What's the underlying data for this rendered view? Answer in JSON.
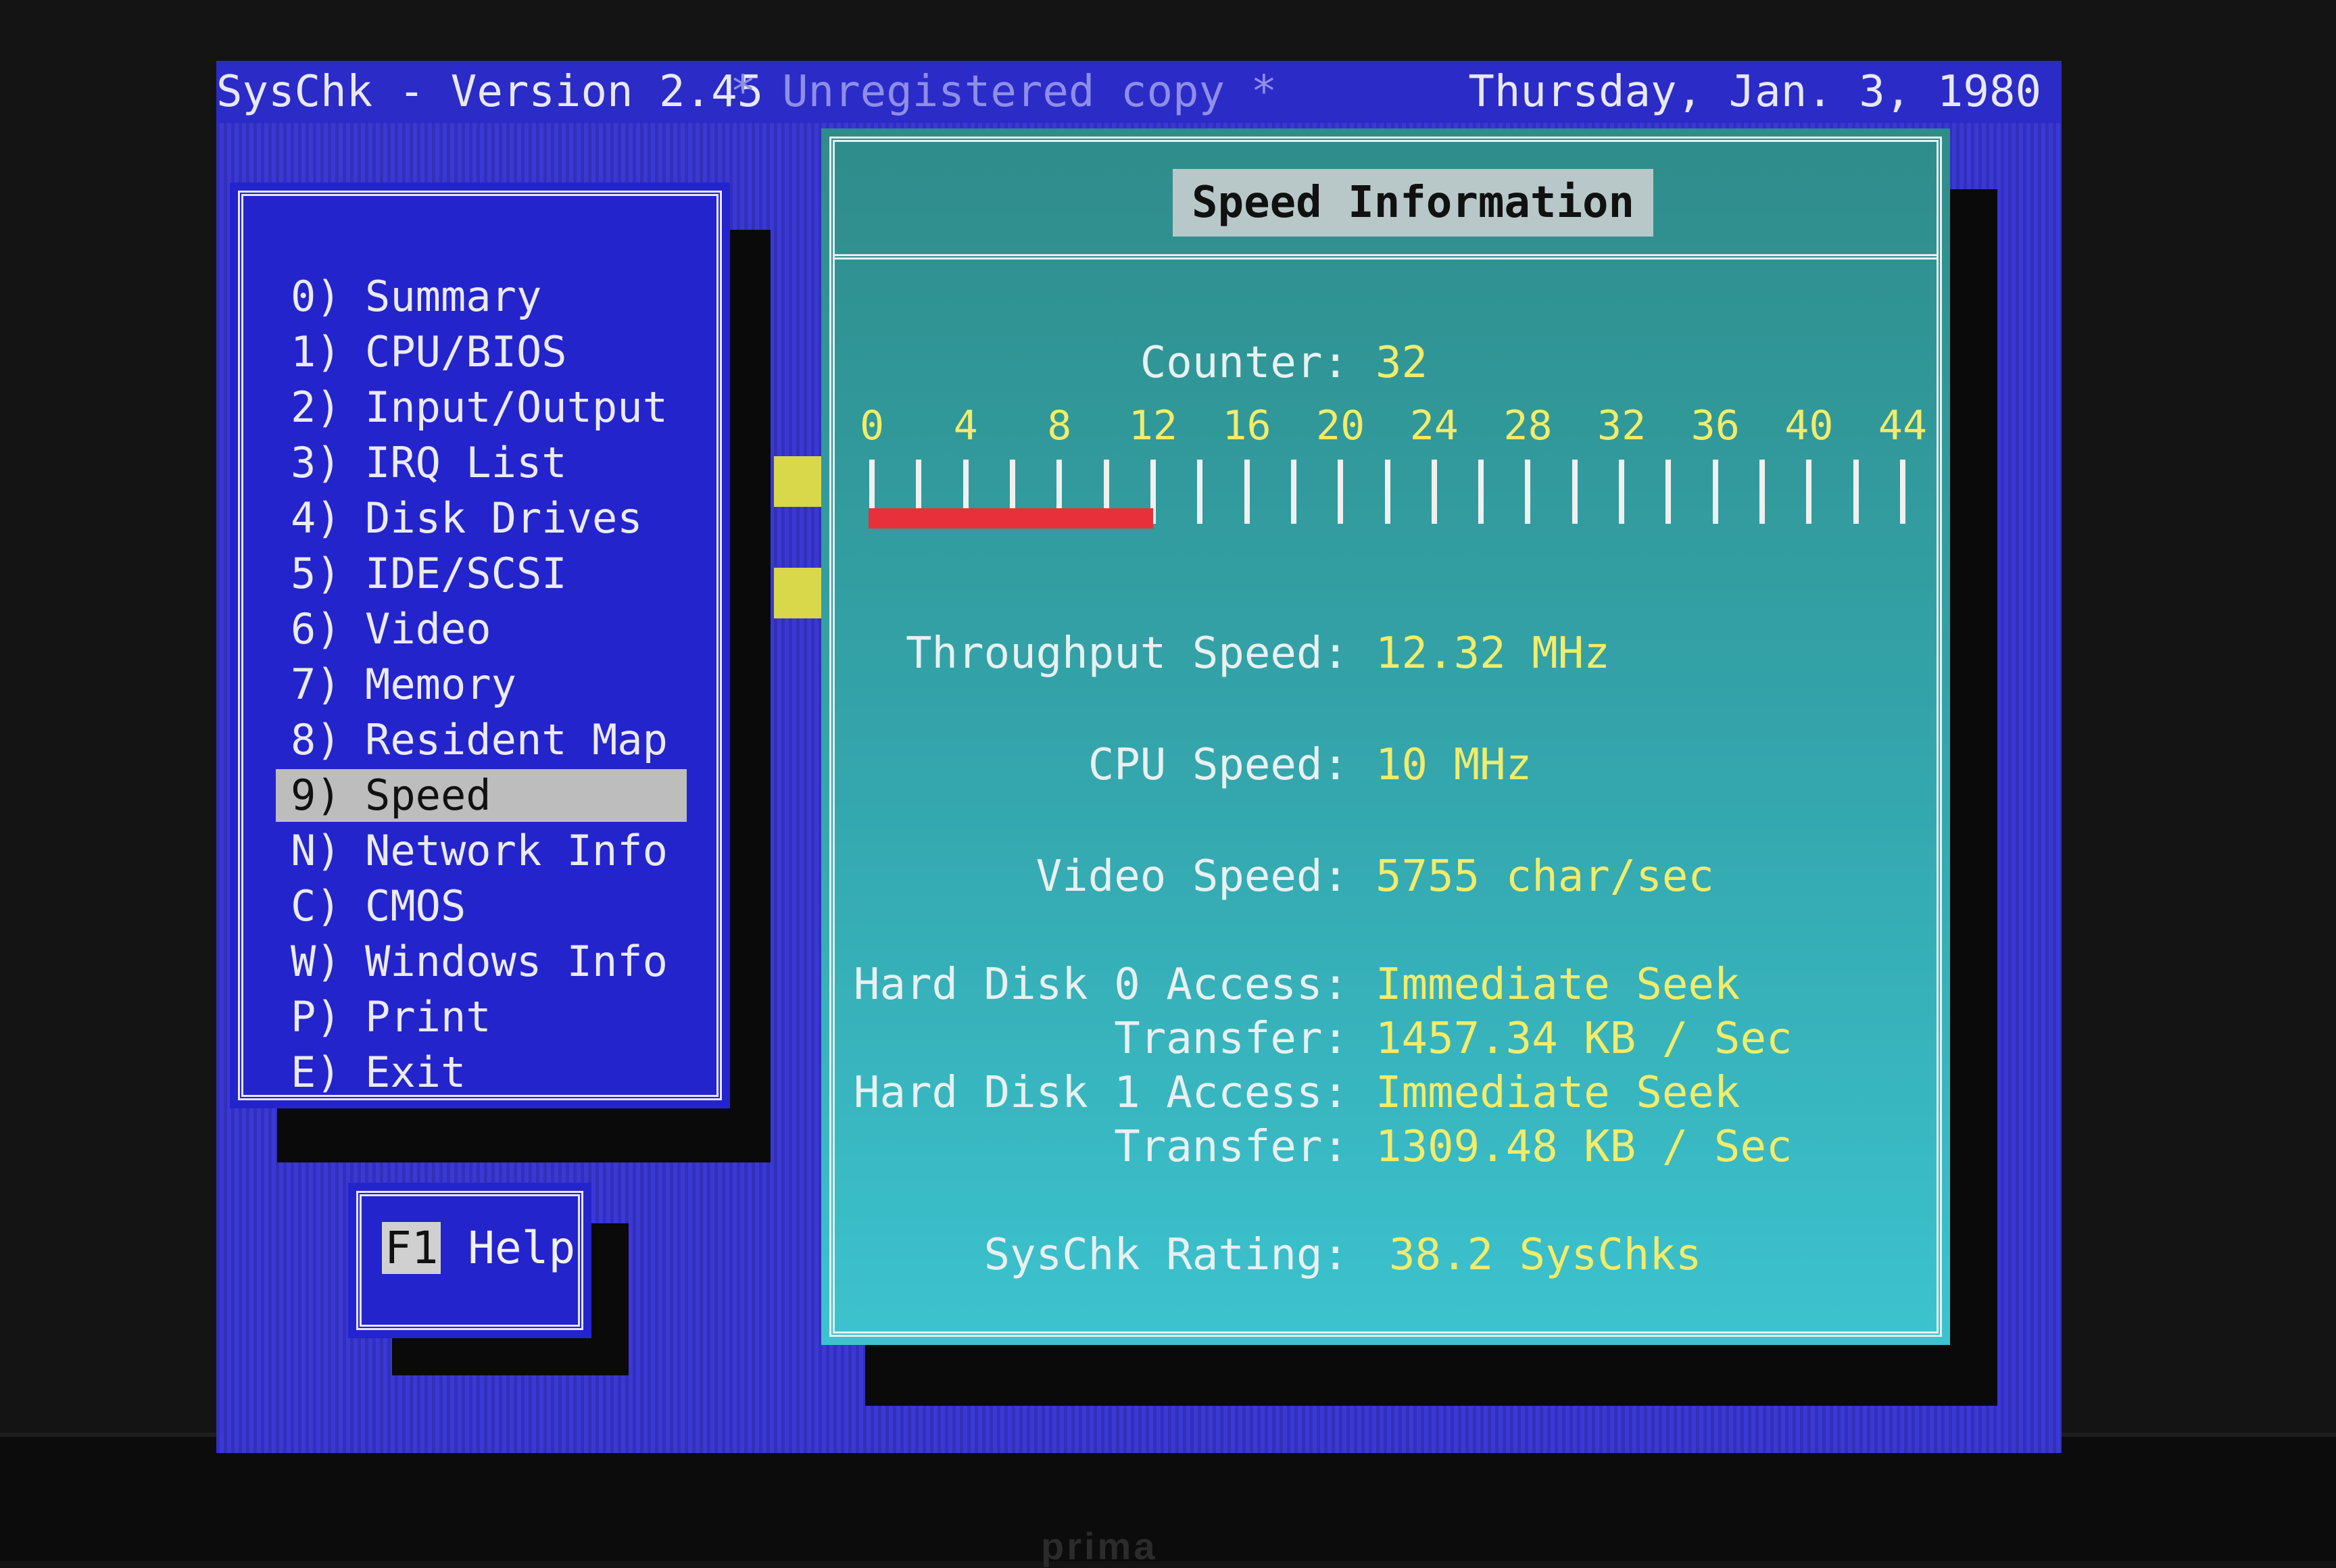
{
  "titlebar": {
    "app": "SysChk - Version 2.45",
    "unregistered": "* Unregistered copy *",
    "date": "Thursday, Jan. 3, 1980"
  },
  "menu": {
    "items": [
      {
        "key": "0)",
        "label": "Summary"
      },
      {
        "key": "1)",
        "label": "CPU/BIOS"
      },
      {
        "key": "2)",
        "label": "Input/Output"
      },
      {
        "key": "3)",
        "label": "IRQ List"
      },
      {
        "key": "4)",
        "label": "Disk Drives"
      },
      {
        "key": "5)",
        "label": "IDE/SCSI"
      },
      {
        "key": "6)",
        "label": "Video"
      },
      {
        "key": "7)",
        "label": "Memory"
      },
      {
        "key": "8)",
        "label": "Resident Map"
      },
      {
        "key": "9)",
        "label": "Speed"
      },
      {
        "key": "N)",
        "label": "Network Info"
      },
      {
        "key": "C)",
        "label": "CMOS"
      },
      {
        "key": "W)",
        "label": "Windows Info"
      },
      {
        "key": "P)",
        "label": "Print"
      },
      {
        "key": "E)",
        "label": "Exit"
      }
    ],
    "selected_index": 9
  },
  "help": {
    "key": "F1",
    "label": "Help"
  },
  "speed": {
    "title": "Speed Information",
    "counter_label": "Counter:",
    "counter_value": "32",
    "scale_labels": [
      "0",
      "4",
      "8",
      "12",
      "16",
      "20",
      "24",
      "28",
      "32",
      "36",
      "40",
      "44"
    ],
    "scale_max": 44,
    "bar_value": 12,
    "throughput_label": "Throughput Speed:",
    "throughput_value": "12.32 MHz",
    "cpu_label": "CPU Speed:",
    "cpu_value": "10 MHz",
    "video_label": "Video Speed:",
    "video_value": "5755 char/sec",
    "hd0_label": "Hard Disk 0 Access:",
    "hd0_value": "Immediate Seek",
    "hd0_transfer_label": "Transfer:",
    "hd0_transfer_value": "1457.34 KB / Sec",
    "hd1_label": "Hard Disk 1 Access:",
    "hd1_value": "Immediate Seek",
    "hd1_transfer_label": "Transfer:",
    "hd1_transfer_value": "1309.48 KB / Sec",
    "rating_label": "SysChk Rating:",
    "rating_value": "38.2 SysChks"
  },
  "colors": {
    "screen_blue": "#3a38d6",
    "panel_teal": "#34a7ae",
    "value_yellow": "#f2ec6a",
    "bar_red": "#e8303a"
  }
}
